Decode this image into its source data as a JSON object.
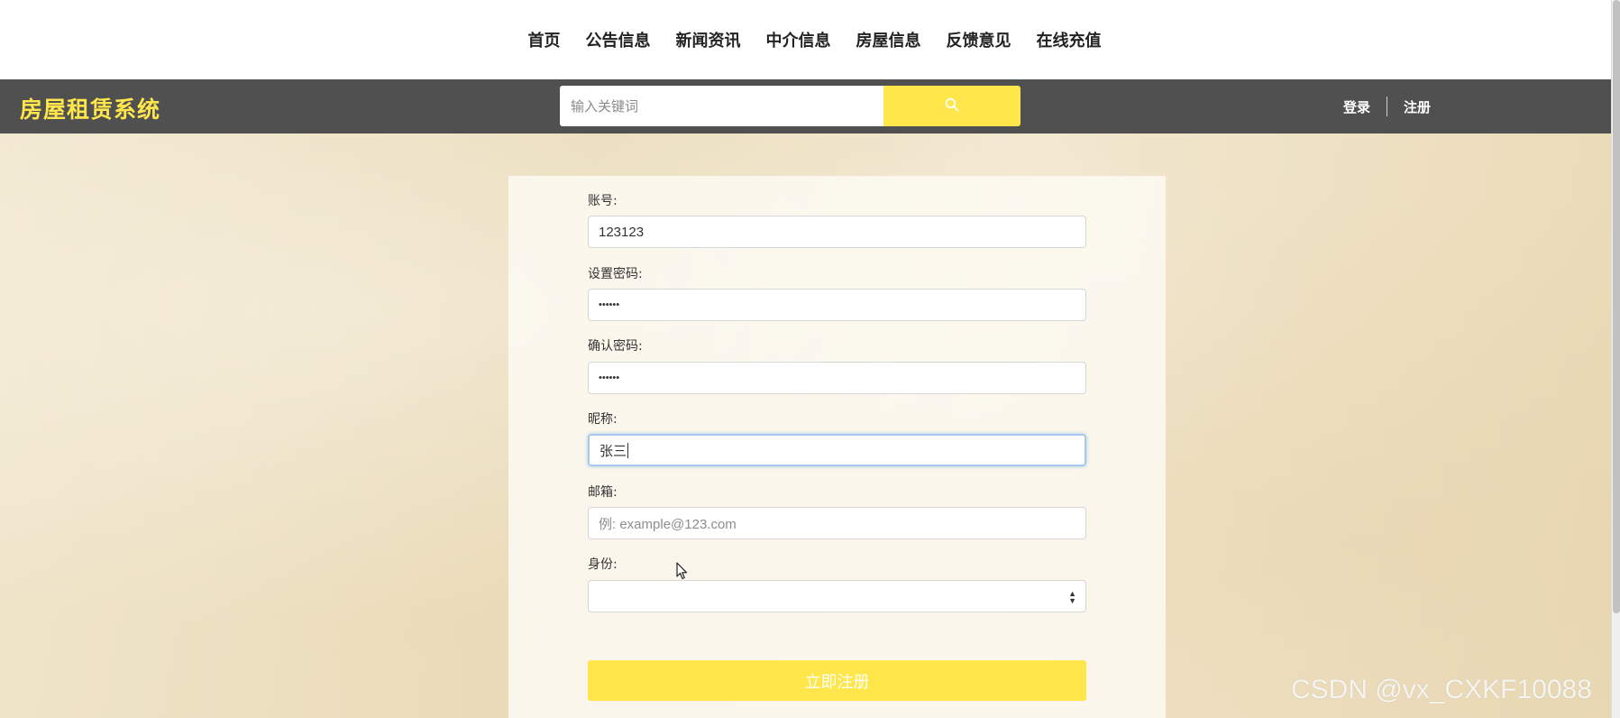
{
  "nav": {
    "items": [
      "首页",
      "公告信息",
      "新闻资讯",
      "中介信息",
      "房屋信息",
      "反馈意见",
      "在线充值"
    ]
  },
  "header": {
    "brand": "房屋租赁系统",
    "search_placeholder": "输入关键词",
    "login": "登录",
    "register": "注册"
  },
  "form": {
    "account_label": "账号:",
    "account_value": "123123",
    "password_label": "设置密码:",
    "password_value": "••••••",
    "confirm_label": "确认密码:",
    "confirm_value": "••••••",
    "nickname_label": "昵称:",
    "nickname_value": "张三",
    "email_label": "邮箱:",
    "email_placeholder": "例: example@123.com",
    "role_label": "身份:",
    "role_value": "",
    "submit_label": "立即注册"
  },
  "watermark": "CSDN @vx_CXKF10088",
  "colors": {
    "accent": "#ffe64a",
    "header_bg": "#505050",
    "focus_border": "#a9c8ee"
  }
}
